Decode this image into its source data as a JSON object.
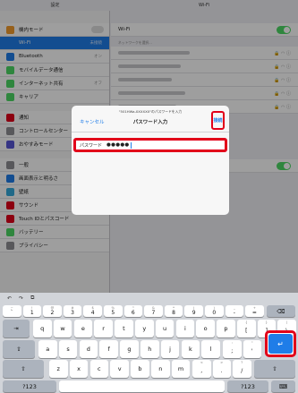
{
  "status_bar": {
    "left_title": "設定",
    "right_title": "Wi-Fi"
  },
  "sidebar": {
    "items": [
      {
        "label": "機内モード",
        "value": "",
        "icon": "airplane-icon",
        "color": "#f39c2c",
        "selected": false,
        "toggle": true
      },
      {
        "label": "Wi-Fi",
        "value": "未接続",
        "icon": "wifi-icon",
        "color": "#1f7de8",
        "selected": true
      },
      {
        "label": "Bluetooth",
        "value": "オン",
        "icon": "bluetooth-icon",
        "color": "#1f7de8",
        "selected": false
      },
      {
        "label": "モバイルデータ通信",
        "value": "",
        "icon": "antenna-icon",
        "color": "#4cd964",
        "selected": false
      },
      {
        "label": "インターネット共有",
        "value": "オフ",
        "icon": "link-icon",
        "color": "#4cd964",
        "selected": false
      },
      {
        "label": "キャリア",
        "value": "",
        "icon": "phone-icon",
        "color": "#4cd964",
        "selected": false
      },
      {
        "label": "通知",
        "value": "",
        "icon": "notification-icon",
        "color": "#e2001a",
        "selected": false,
        "gap": true
      },
      {
        "label": "コントロールセンター",
        "value": "",
        "icon": "control-center-icon",
        "color": "#8e8e93",
        "selected": false
      },
      {
        "label": "おやすみモード",
        "value": "",
        "icon": "moon-icon",
        "color": "#5856d6",
        "selected": false
      },
      {
        "label": "一般",
        "value": "",
        "icon": "gear-icon",
        "color": "#8e8e93",
        "selected": false,
        "gap": true
      },
      {
        "label": "画面表示と明るさ",
        "value": "",
        "icon": "brightness-icon",
        "color": "#1f7de8",
        "selected": false
      },
      {
        "label": "壁紙",
        "value": "",
        "icon": "wallpaper-icon",
        "color": "#34aadc",
        "selected": false
      },
      {
        "label": "サウンド",
        "value": "",
        "icon": "sound-icon",
        "color": "#e2001a",
        "selected": false
      },
      {
        "label": "Touch IDとパスコード",
        "value": "",
        "icon": "fingerprint-icon",
        "color": "#e2001a",
        "selected": false
      },
      {
        "label": "バッテリー",
        "value": "",
        "icon": "battery-icon",
        "color": "#4cd964",
        "selected": false
      },
      {
        "label": "プライバシー",
        "value": "",
        "icon": "hand-icon",
        "color": "#8e8e93",
        "selected": false
      }
    ]
  },
  "detail": {
    "wifi_label": "Wi-Fi",
    "network_section_note": "ネットワークを選択..."
  },
  "dialog": {
    "subtitle": "\"501HWa-XXXXXX\"のパスワードを入力",
    "title": "パスワード入力",
    "cancel_label": "キャンセル",
    "join_label": "接続",
    "password_label": "パスワード",
    "password_value": "●●●●●"
  },
  "keyboard": {
    "toolbar": [
      "↶",
      "↷",
      "⧉"
    ],
    "number_row": [
      {
        "sub": "~",
        "main": "`"
      },
      {
        "sub": "!",
        "main": "1"
      },
      {
        "sub": "@",
        "main": "2"
      },
      {
        "sub": "#",
        "main": "3"
      },
      {
        "sub": "$",
        "main": "4"
      },
      {
        "sub": "%",
        "main": "5"
      },
      {
        "sub": "^",
        "main": "6"
      },
      {
        "sub": "&",
        "main": "7"
      },
      {
        "sub": "*",
        "main": "8"
      },
      {
        "sub": "(",
        "main": "9"
      },
      {
        "sub": ")",
        "main": "0"
      },
      {
        "sub": "_",
        "main": "-"
      },
      {
        "sub": "+",
        "main": "="
      }
    ],
    "delete_key": "⌫",
    "tab_key": "⇥",
    "row1": [
      "q",
      "w",
      "e",
      "r",
      "t",
      "y",
      "u",
      "i",
      "o",
      "p"
    ],
    "row1_extra": [
      {
        "sub": "{",
        "main": "["
      },
      {
        "sub": "}",
        "main": "]"
      },
      {
        "sub": "|",
        "main": "\\"
      }
    ],
    "caps_key": "⇪",
    "row2": [
      "a",
      "s",
      "d",
      "f",
      "g",
      "h",
      "j",
      "k",
      "l"
    ],
    "row2_extra": [
      {
        "sub": ":",
        "main": ";"
      },
      {
        "sub": "\"",
        "main": "'"
      }
    ],
    "return_key": "↵",
    "shift_key": "⇧",
    "row3": [
      "z",
      "x",
      "c",
      "v",
      "b",
      "n",
      "m"
    ],
    "row3_extra": [
      {
        "sub": "<",
        "main": ","
      },
      {
        "sub": ">",
        "main": "."
      },
      {
        "sub": "?",
        "main": "/"
      }
    ],
    "shift_right": "⇧",
    "mode_key_left": "?123",
    "mode_key_right": "?123",
    "hide_key": "⌨"
  }
}
